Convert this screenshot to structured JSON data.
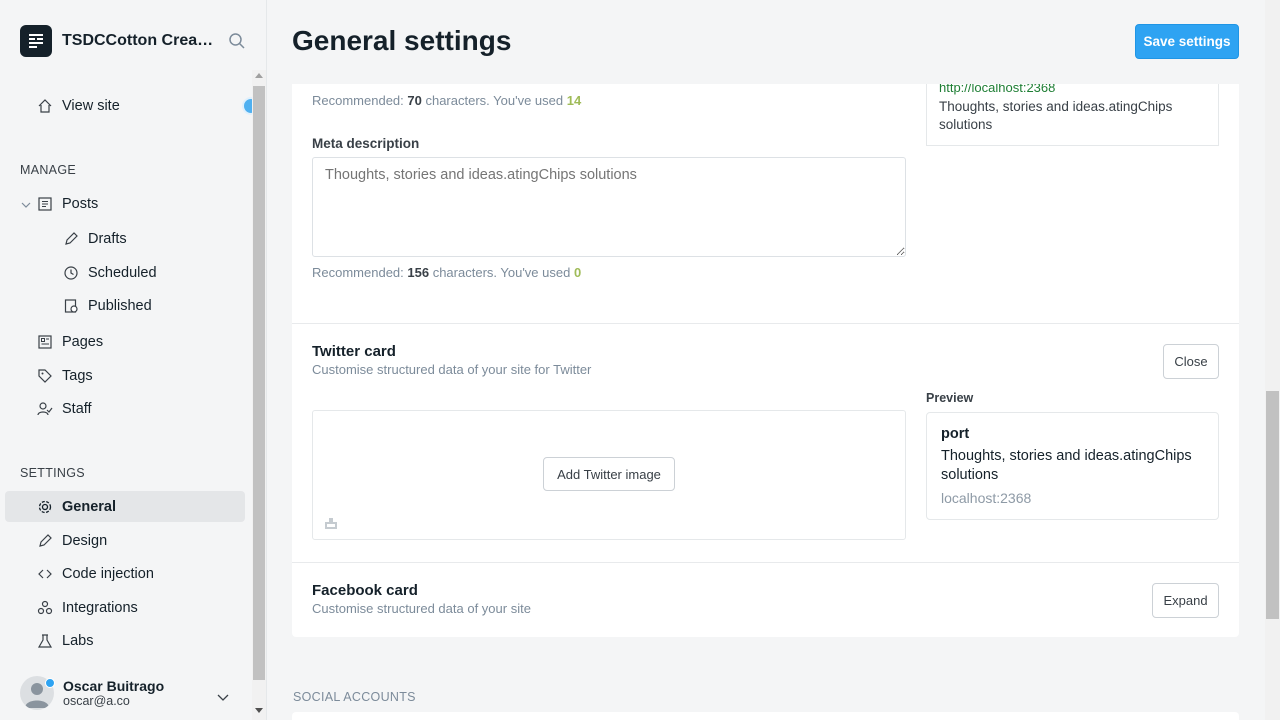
{
  "brand": {
    "name": "TSDCCotton Creati..."
  },
  "sidebar": {
    "view_site": "View site",
    "manage_heading": "MANAGE",
    "posts": "Posts",
    "drafts": "Drafts",
    "scheduled": "Scheduled",
    "published": "Published",
    "pages": "Pages",
    "tags": "Tags",
    "staff": "Staff",
    "settings_heading": "SETTINGS",
    "general": "General",
    "design": "Design",
    "code_injection": "Code injection",
    "integrations": "Integrations",
    "labs": "Labs"
  },
  "user": {
    "name": "Oscar Buitrago",
    "email": "oscar@a.co"
  },
  "header": {
    "title": "General settings",
    "save_label": "Save settings"
  },
  "meta": {
    "title_rec_prefix": "Recommended: ",
    "title_rec_count": "70",
    "title_rec_mid": " characters. You've used ",
    "title_used": "14",
    "description_label": "Meta description",
    "description_placeholder": "Thoughts, stories and ideas.atingChips solutions",
    "desc_rec_prefix": "Recommended: ",
    "desc_rec_count": "156",
    "desc_rec_mid": " characters. You've used ",
    "desc_used": "0",
    "preview_url": "http://localhost:2368",
    "preview_desc": "Thoughts, stories and ideas.atingChips solutions"
  },
  "twitter": {
    "title": "Twitter card",
    "subtitle": "Customise structured data of your site for Twitter",
    "close_label": "Close",
    "add_image_label": "Add Twitter image",
    "preview_label": "Preview",
    "card_title": "port",
    "card_desc": "Thoughts, stories and ideas.atingChips solutions",
    "card_url": "localhost:2368"
  },
  "facebook": {
    "title": "Facebook card",
    "subtitle": "Customise structured data of your site",
    "expand_label": "Expand"
  },
  "social": {
    "heading": "SOCIAL ACCOUNTS"
  },
  "colors": {
    "accent": "#2ea3f2",
    "used_count": "#9fbb58",
    "preview_url": "#1e7e34"
  }
}
